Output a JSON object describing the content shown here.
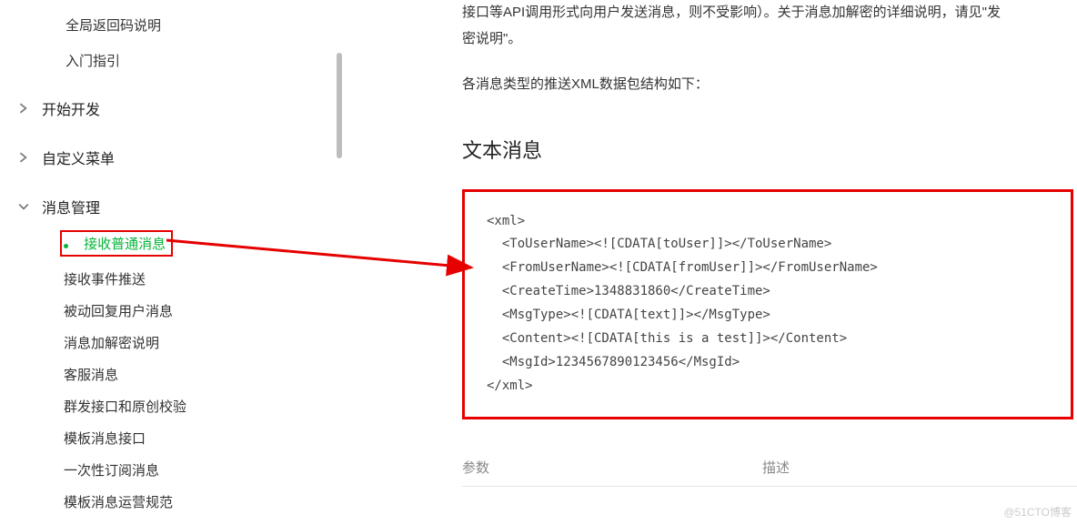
{
  "sidebar": {
    "top_items": [
      {
        "label": "全局返回码说明"
      },
      {
        "label": "入门指引"
      }
    ],
    "sections": [
      {
        "label": "开始开发",
        "expanded": false
      },
      {
        "label": "自定义菜单",
        "expanded": false
      },
      {
        "label": "消息管理",
        "expanded": true,
        "children": [
          {
            "label": "接收普通消息",
            "active": true
          },
          {
            "label": "接收事件推送"
          },
          {
            "label": "被动回复用户消息"
          },
          {
            "label": "消息加解密说明"
          },
          {
            "label": "客服消息"
          },
          {
            "label": "群发接口和原创校验"
          },
          {
            "label": "模板消息接口"
          },
          {
            "label": "一次性订阅消息"
          },
          {
            "label": "模板消息运营规范"
          }
        ]
      }
    ]
  },
  "content": {
    "intro1": "接口等API调用形式向用户发送消息，则不受影响）。关于消息加解密的详细说明，请见\"发",
    "intro2": "密说明\"。",
    "intro3": "各消息类型的推送XML数据包结构如下：",
    "section_title": "文本消息",
    "code": "<xml>\n  <ToUserName><![CDATA[toUser]]></ToUserName>\n  <FromUserName><![CDATA[fromUser]]></FromUserName>\n  <CreateTime>1348831860</CreateTime>\n  <MsgType><![CDATA[text]]></MsgType>\n  <Content><![CDATA[this is a test]]></Content>\n  <MsgId>1234567890123456</MsgId>\n</xml>",
    "table": {
      "col1": "参数",
      "col2": "描述"
    }
  },
  "watermark": "@51CTO博客"
}
